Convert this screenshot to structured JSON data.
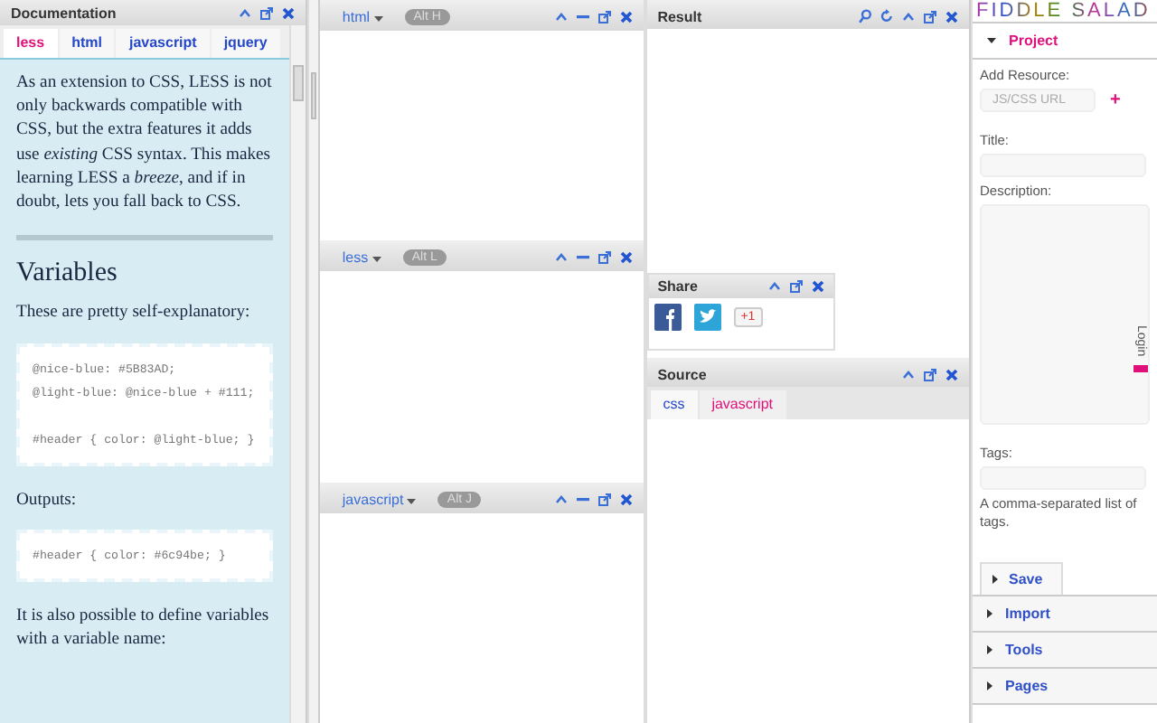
{
  "documentation": {
    "title": "Documentation",
    "tabs": [
      {
        "label": "less",
        "selected": true
      },
      {
        "label": "html",
        "selected": false
      },
      {
        "label": "javascript",
        "selected": false
      },
      {
        "label": "jquery",
        "selected": false
      }
    ],
    "blocks": [
      {
        "kind": "paragraph",
        "text": "As an extension to CSS, LESS is not only backwards compatible with CSS, but the extra features it adds use *existing* CSS syntax. This makes learning LESS a *breeze*, and if in doubt, lets you fall back to CSS."
      },
      {
        "kind": "rule"
      },
      {
        "kind": "heading",
        "text": "Variables"
      },
      {
        "kind": "paragraph",
        "text": "These are pretty self-explanatory:"
      },
      {
        "kind": "code",
        "groups": [
          [
            "@nice-blue: #5B83AD;",
            "@light-blue: @nice-blue + #111;"
          ],
          [
            "#header { color: @light-blue; }"
          ]
        ]
      },
      {
        "kind": "paragraph",
        "text": "Outputs:"
      },
      {
        "kind": "code",
        "groups": [
          [
            "#header { color: #6c94be; }"
          ]
        ]
      },
      {
        "kind": "paragraph",
        "text": "It is also possible to define variables with a variable name:"
      }
    ]
  },
  "editors": [
    {
      "mode": "html",
      "shortcut": "Alt H"
    },
    {
      "mode": "less",
      "shortcut": "Alt L"
    },
    {
      "mode": "javascript",
      "shortcut": "Alt J"
    }
  ],
  "result": {
    "title": "Result"
  },
  "share": {
    "title": "Share",
    "plus_one": "+1"
  },
  "source": {
    "title": "Source",
    "tabs": [
      {
        "label": "css",
        "selected": false
      },
      {
        "label": "javascript",
        "selected": true
      }
    ]
  },
  "sidebar": {
    "logo": "FIDDLE SALAD",
    "sections": [
      {
        "label": "Project",
        "expanded": true
      },
      {
        "label": "Import",
        "expanded": false
      },
      {
        "label": "Tools",
        "expanded": false
      },
      {
        "label": "Pages",
        "expanded": false
      }
    ],
    "add_resource": {
      "label": "Add Resource:",
      "placeholder": "JS/CSS URL",
      "add": "+"
    },
    "title_label": "Title:",
    "description_label": "Description:",
    "login": "Login",
    "tags_label": "Tags:",
    "tags_hint": "A comma-separated list of tags.",
    "save": "Save"
  }
}
